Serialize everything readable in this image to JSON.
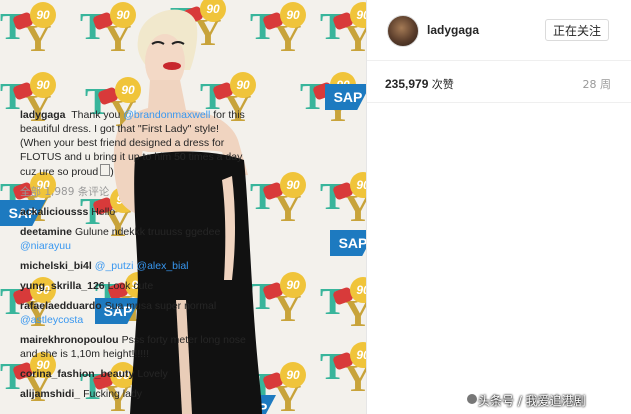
{
  "watermark": "头条号 / 我爱追港剧",
  "post": {
    "username": "ladygaga",
    "follow_label": "正在关注",
    "likes_count": "235,979",
    "likes_unit": "次赞",
    "age": "28 周",
    "photo": {
      "tile_letters_t": "T",
      "tile_letters_y": "Y",
      "tile_ninety": "90",
      "sap_logo": "SAP"
    }
  },
  "caption": {
    "username": "ladygaga",
    "text_1": "Thank you",
    "mention": "@brandonmaxwell",
    "text_2": "for this beautiful dress. I got that \"First Lady\" style! (When your best friend designed a dress for FLOTUS and u bring it up to him 50 times a day cuz ure so proud"
  },
  "view_all_comments": "全部 1,989 条评论",
  "comments": [
    {
      "user": "ackaliciousss",
      "text": "Hello",
      "mentions": []
    },
    {
      "user": "deetamine",
      "text": "Gulune ndekkk truuuss ggedee",
      "mentions": [
        "@niarayuu"
      ]
    },
    {
      "user": "michelski_bi4l",
      "text": "",
      "mentions": [
        "@_putzi",
        "@alex_bial"
      ]
    },
    {
      "user": "yung_skrilla_126",
      "text": "Look cute",
      "mentions": []
    },
    {
      "user": "rafaelaedduardo",
      "text": "Sua musa super normal",
      "mentions": [
        "@astleycosta"
      ]
    },
    {
      "user": "mairekhronopoulou",
      "text": "Psss forty meter long nose and she is 1,10m height!!!!!!",
      "mentions": []
    },
    {
      "user": "corina_fashion_beauty",
      "text": "Lovely",
      "mentions": []
    },
    {
      "user": "alijamshidi_",
      "text": "Fucking lady",
      "mentions": []
    }
  ]
}
